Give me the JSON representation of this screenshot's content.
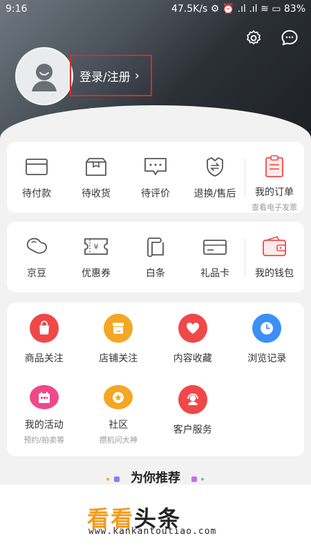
{
  "status_bar": {
    "time": "9:16",
    "right": "47.5K/s ⚙ ⏰ .ıl .ıl ≋ ▭ 83%"
  },
  "header": {
    "login_label": "登录/注册",
    "chevron": "›"
  },
  "orders": {
    "items": [
      {
        "label": "待付款",
        "icon": "wallet-card-icon"
      },
      {
        "label": "待收货",
        "icon": "package-box-icon"
      },
      {
        "label": "待评价",
        "icon": "comment-bubble-icon"
      },
      {
        "label": "退换/售后",
        "icon": "return-icon"
      },
      {
        "label": "我的订单",
        "sub": "查看电子发票",
        "icon": "order-clipboard-icon"
      }
    ]
  },
  "wallet": {
    "items": [
      {
        "label": "京豆",
        "icon": "bean-icon"
      },
      {
        "label": "优惠券",
        "icon": "coupon-icon"
      },
      {
        "label": "白条",
        "icon": "iou-scroll-icon"
      },
      {
        "label": "礼品卡",
        "icon": "gift-card-icon"
      },
      {
        "label": "我的钱包",
        "icon": "wallet-icon"
      }
    ]
  },
  "services": {
    "items": [
      {
        "label": "商品关注",
        "color": "#f04848",
        "icon": "shopping-bag-icon"
      },
      {
        "label": "店铺关注",
        "color": "#f5a623",
        "icon": "store-icon"
      },
      {
        "label": "内容收藏",
        "color": "#f04848",
        "icon": "heart-icon"
      },
      {
        "label": "浏览记录",
        "color": "#3b8ff5",
        "icon": "clock-icon"
      },
      {
        "label": "我的活动",
        "sub": "预约/拍卖等",
        "color": "#f0488a",
        "icon": "calendar-icon"
      },
      {
        "label": "社区",
        "sub": "攒机问大神",
        "color": "#f5a623",
        "icon": "community-icon"
      },
      {
        "label": "客户服务",
        "color": "#f04848",
        "icon": "headset-icon"
      }
    ]
  },
  "recommend": {
    "title": "为你推荐"
  },
  "watermark": {
    "part1": "看看",
    "part2": "头条",
    "url": "www.kankantoutiao.com"
  }
}
